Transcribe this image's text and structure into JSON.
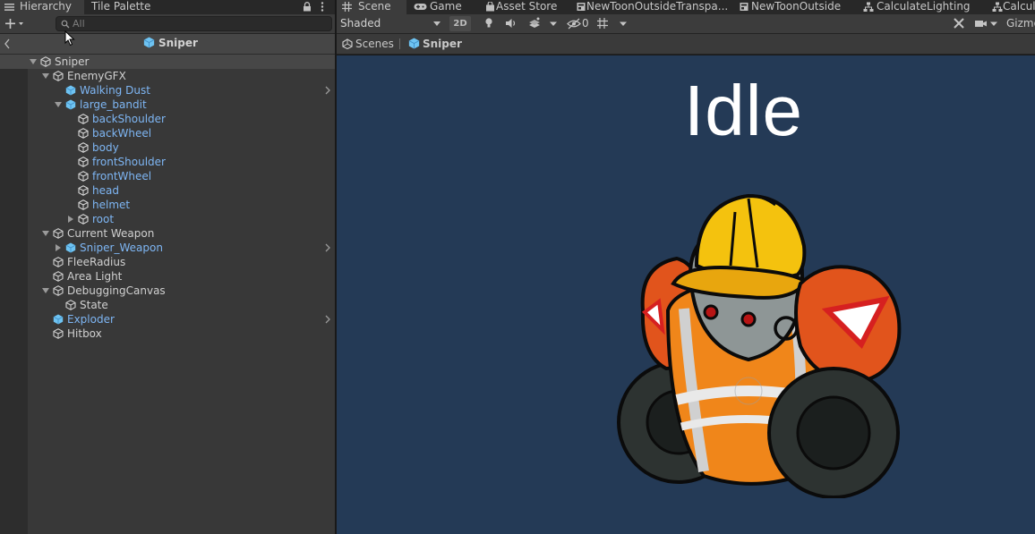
{
  "hierarchy": {
    "tab_label": "Hierarchy",
    "second_tab_label": "Tile Palette",
    "search_placeholder": "All",
    "breadcrumb_title": "Sniper",
    "items": [
      {
        "label": "Sniper",
        "depth": 0,
        "expanded": true,
        "prefab": false,
        "selected": true
      },
      {
        "label": "EnemyGFX",
        "depth": 1,
        "expanded": true,
        "prefab": false
      },
      {
        "label": "Walking Dust",
        "depth": 2,
        "prefab": true,
        "chevron": true
      },
      {
        "label": "large_bandit",
        "depth": 2,
        "expanded": true,
        "prefab": true
      },
      {
        "label": "backShoulder",
        "depth": 3,
        "prefab": true
      },
      {
        "label": "backWheel",
        "depth": 3,
        "prefab": true
      },
      {
        "label": "body",
        "depth": 3,
        "prefab": true
      },
      {
        "label": "frontShoulder",
        "depth": 3,
        "prefab": true
      },
      {
        "label": "frontWheel",
        "depth": 3,
        "prefab": true
      },
      {
        "label": "head",
        "depth": 3,
        "prefab": true
      },
      {
        "label": "helmet",
        "depth": 3,
        "prefab": true
      },
      {
        "label": "root",
        "depth": 3,
        "expanded": false,
        "prefab": true
      },
      {
        "label": "Current Weapon",
        "depth": 1,
        "expanded": true,
        "prefab": false
      },
      {
        "label": "Sniper_Weapon",
        "depth": 2,
        "expanded": false,
        "prefab": true,
        "prefab_root": true,
        "chevron": true
      },
      {
        "label": "FleeRadius",
        "depth": 1,
        "prefab": false
      },
      {
        "label": "Area Light",
        "depth": 1,
        "prefab": false
      },
      {
        "label": "DebuggingCanvas",
        "depth": 1,
        "expanded": true,
        "prefab": false
      },
      {
        "label": "State",
        "depth": 2,
        "prefab": false
      },
      {
        "label": "Exploder",
        "depth": 1,
        "prefab": true,
        "prefab_root": true,
        "chevron": true
      },
      {
        "label": "Hitbox",
        "depth": 1,
        "prefab": false
      }
    ]
  },
  "scene": {
    "tabs": [
      {
        "label": "Scene",
        "icon": "grid-icon",
        "active": true
      },
      {
        "label": "Game",
        "icon": "gamepad-icon"
      },
      {
        "label": "Asset Store",
        "icon": "shopping-bag-icon"
      },
      {
        "label": "NewToonOutsideTranspa...",
        "icon": "shader-graph-icon"
      },
      {
        "label": "NewToonOutside",
        "icon": "shader-graph-icon"
      },
      {
        "label": "CalculateLighting",
        "icon": "subgraph-icon"
      },
      {
        "label": "Calcul",
        "icon": "subgraph-icon"
      }
    ],
    "shading_mode": "Shaded",
    "mode_2d_label": "2D",
    "hidden_count": "0",
    "gizmos_label": "Gizmo",
    "breadcrumb_root": "Scenes",
    "breadcrumb_current": "Sniper",
    "state_label": "Idle"
  },
  "colors": {
    "prefab_text": "#7eb6f4",
    "viewport_bg": "#243a56",
    "panel_bg": "#383838"
  }
}
